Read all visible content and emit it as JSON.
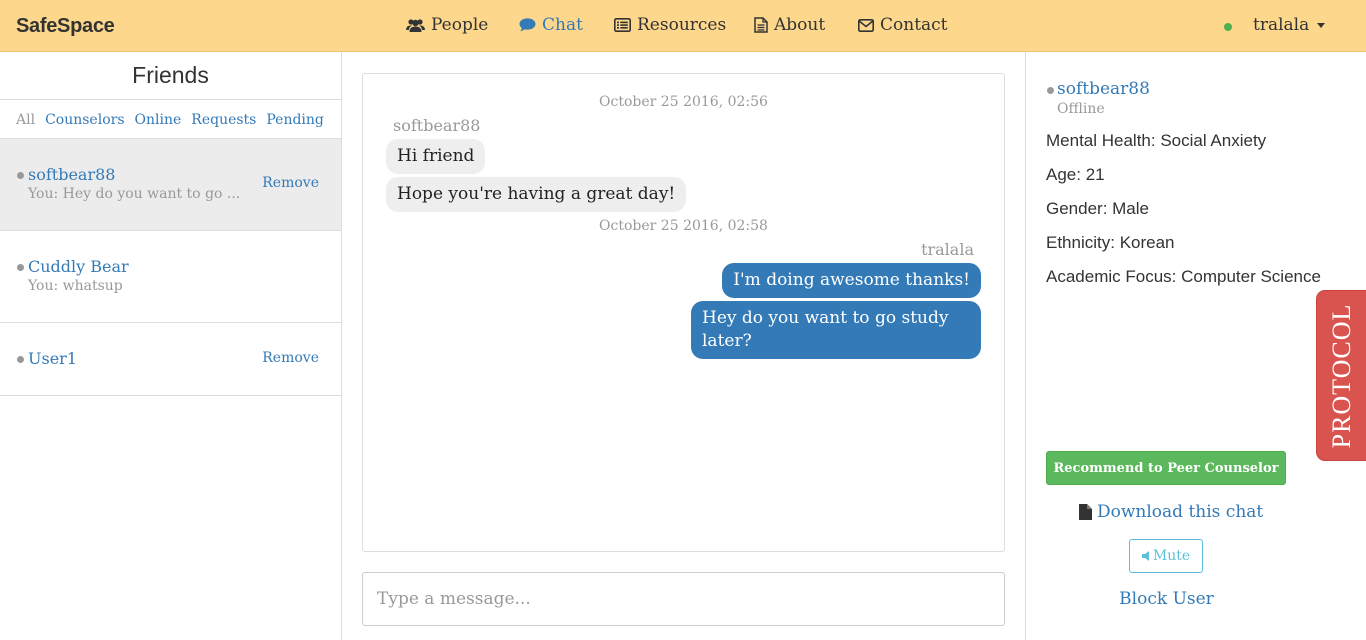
{
  "navbar": {
    "brand": "SafeSpace",
    "items": [
      {
        "label": "People",
        "icon": "users-icon"
      },
      {
        "label": "Chat",
        "icon": "comment-icon",
        "active": true
      },
      {
        "label": "Resources",
        "icon": "list-alt-icon"
      },
      {
        "label": "About",
        "icon": "file-text-icon"
      },
      {
        "label": "Contact",
        "icon": "envelope-icon"
      }
    ],
    "username": "tralala",
    "user_status_color": "#4caf50"
  },
  "friends": {
    "title": "Friends",
    "filters": [
      "All",
      "Counselors",
      "Online",
      "Requests",
      "Pending"
    ],
    "list": [
      {
        "name": "softbear88",
        "preview": "You: Hey do you want to go ...",
        "action": "Remove"
      },
      {
        "name": "Cuddly Bear",
        "preview": "You: whatsup",
        "action": ""
      },
      {
        "name": "User1",
        "preview": "",
        "action": "Remove"
      }
    ]
  },
  "chat": {
    "timestamps": [
      "October 25 2016, 02:56",
      "October 25 2016, 02:58"
    ],
    "senders": [
      "softbear88",
      "tralala"
    ],
    "messages": [
      {
        "from": "softbear88",
        "text": "Hi friend"
      },
      {
        "from": "softbear88",
        "text": "Hope you're having a great day!"
      },
      {
        "from": "tralala",
        "text": "I'm doing awesome thanks!"
      },
      {
        "from": "tralala",
        "text": "Hey do you want to go study later?"
      }
    ],
    "input_placeholder": "Type a message..."
  },
  "profile": {
    "name": "softbear88",
    "status": "Offline",
    "fields": [
      "Mental Health: Social Anxiety",
      "Age: 21",
      "Gender: Male",
      "Ethnicity: Korean",
      "Academic Focus: Computer Science"
    ],
    "recommend_label": "Recommend to Peer Counselor",
    "download_label": "Download this chat",
    "mute_label": "Mute",
    "block_label": "Block User"
  },
  "protocol_label": "PROTOCOL",
  "colors": {
    "navbar": "#fdd78b",
    "link": "#337ab7",
    "bubble_out": "#337ab7",
    "bubble_in": "#eeeeee",
    "recommend": "#5cb85c",
    "protocol": "#d9534f",
    "mute": "#5bc0de"
  }
}
